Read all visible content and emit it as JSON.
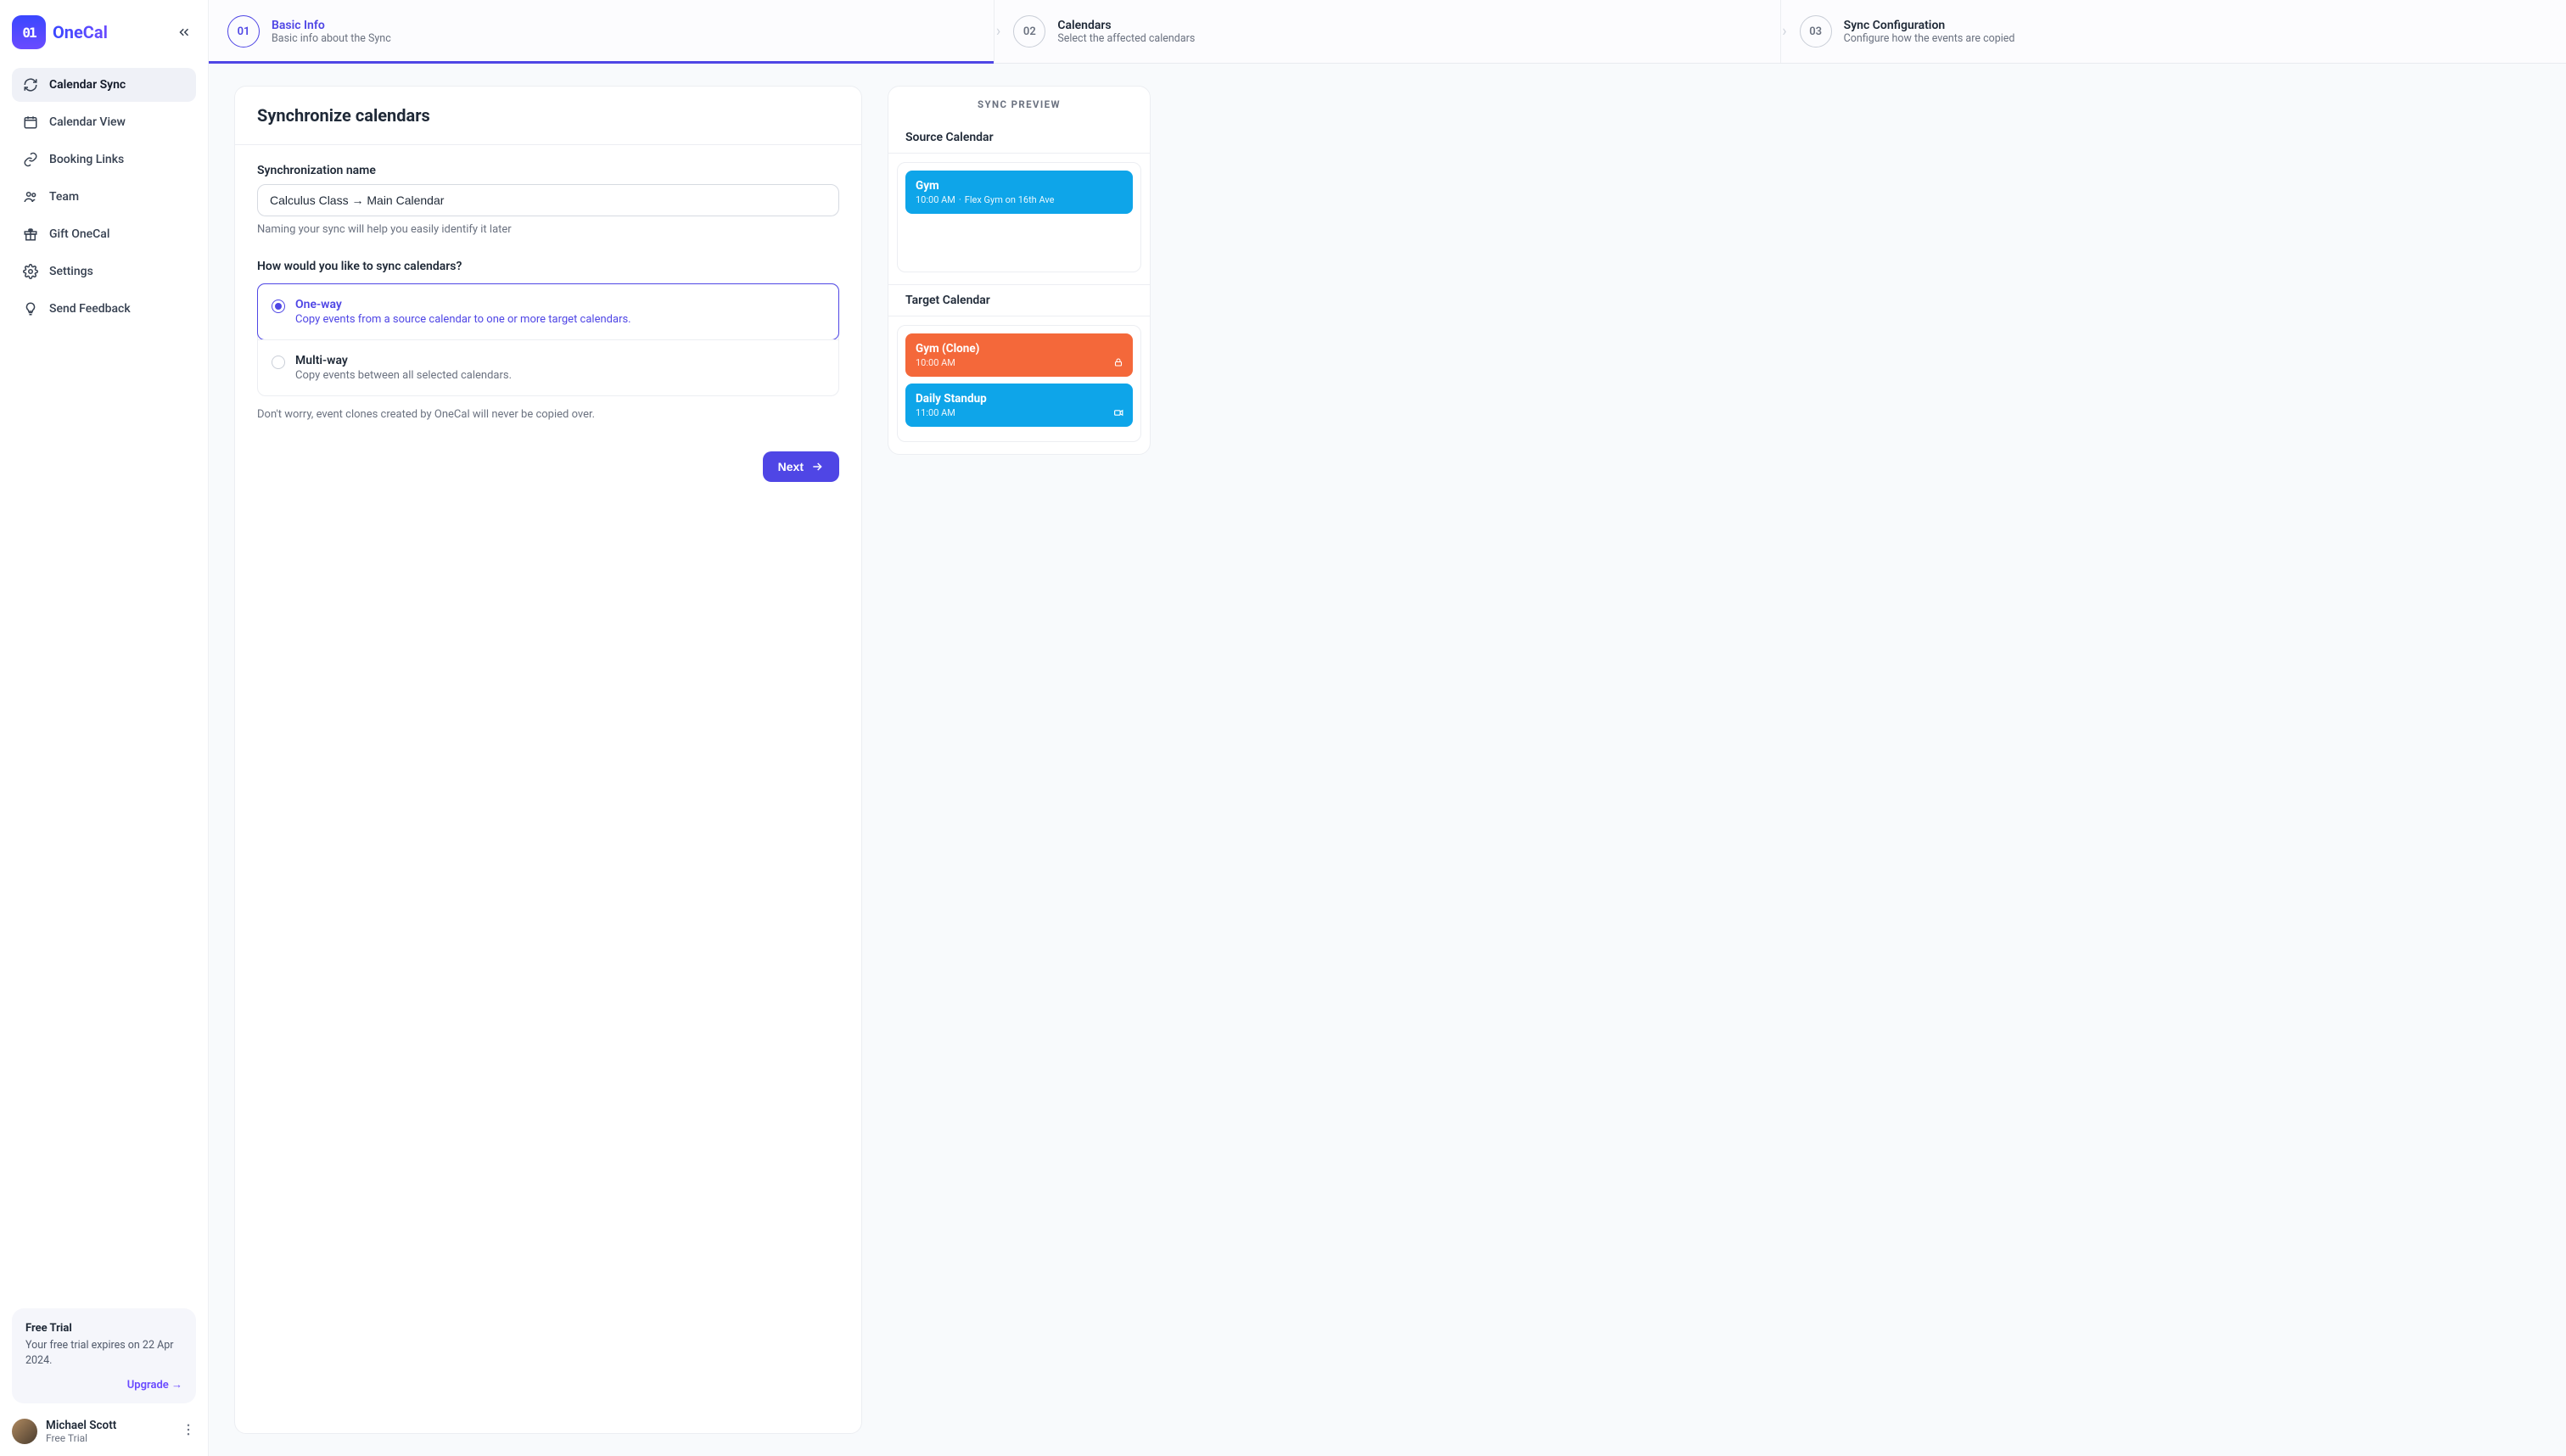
{
  "brand": {
    "badge": "01",
    "word": "OneCal"
  },
  "sidebar": {
    "items": [
      {
        "label": "Calendar Sync"
      },
      {
        "label": "Calendar View"
      },
      {
        "label": "Booking Links"
      },
      {
        "label": "Team"
      },
      {
        "label": "Gift OneCal"
      },
      {
        "label": "Settings"
      },
      {
        "label": "Send Feedback"
      }
    ],
    "active_index": 0
  },
  "trial": {
    "title": "Free Trial",
    "text": "Your free trial expires on 22 Apr 2024.",
    "upgrade_label": "Upgrade →"
  },
  "user": {
    "name": "Michael Scott",
    "plan": "Free Trial"
  },
  "stepper": {
    "active_index": 0,
    "steps": [
      {
        "num": "01",
        "title": "Basic Info",
        "sub": "Basic info about the Sync"
      },
      {
        "num": "02",
        "title": "Calendars",
        "sub": "Select the affected calendars"
      },
      {
        "num": "03",
        "title": "Sync Configuration",
        "sub": "Configure how the events are copied"
      }
    ]
  },
  "form": {
    "heading": "Synchronize calendars",
    "name_label": "Synchronization name",
    "name_value": "Calculus Class → Main Calendar",
    "name_helper": "Naming your sync will help you easily identify it later",
    "sync_question": "How would you like to sync calendars?",
    "options": [
      {
        "title": "One-way",
        "sub": "Copy events from a source calendar to one or more target calendars."
      },
      {
        "title": "Multi-way",
        "sub": "Copy events between all selected calendars."
      }
    ],
    "selected_option_index": 0,
    "footnote": "Don't worry, event clones created by OneCal will never be copied over.",
    "next_label": "Next"
  },
  "preview": {
    "header": "SYNC PREVIEW",
    "sections": [
      {
        "title": "Source Calendar",
        "events": [
          {
            "title": "Gym",
            "time": "10:00 AM",
            "extra": "Flex Gym on 16th Ave",
            "color": "blue",
            "icon": ""
          }
        ]
      },
      {
        "title": "Target Calendar",
        "events": [
          {
            "title": "Gym (Clone)",
            "time": "10:00 AM",
            "extra": "",
            "color": "orange",
            "icon": "lock"
          },
          {
            "title": "Daily Standup",
            "time": "11:00 AM",
            "extra": "",
            "color": "blue",
            "icon": "video"
          }
        ]
      }
    ]
  }
}
